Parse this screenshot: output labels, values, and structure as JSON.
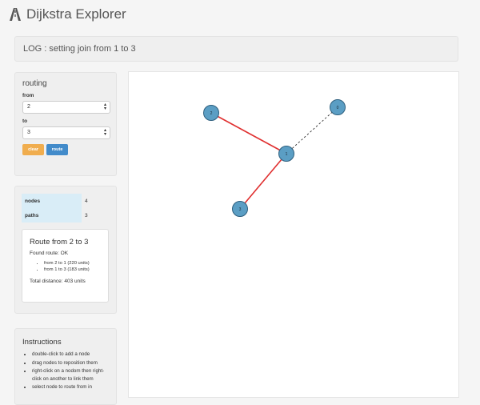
{
  "app": {
    "title": "Dijkstra Explorer",
    "logo_icon": "road-icon"
  },
  "log": {
    "text": "LOG : setting join from 1 to 3"
  },
  "routing": {
    "title": "routing",
    "from_label": "from",
    "from_value": "2",
    "to_label": "to",
    "to_value": "3",
    "clear_label": "clear",
    "route_label": "route",
    "clear_color": "#f0ad4e",
    "route_color": "#428bca"
  },
  "stats": {
    "nodes_label": "nodes",
    "nodes_value": "4",
    "paths_label": "paths",
    "paths_value": "3"
  },
  "route_result": {
    "title": "Route from 2 to 3",
    "status": "Found route: OK",
    "steps": [
      "from 2 to 1 (220 units)",
      "from 1 to 3 (183 units)"
    ],
    "total": "Total distance: 403 units"
  },
  "instructions": {
    "title": "Instructions",
    "items": [
      "double-click to add a node",
      "drag nodes to reposition them",
      "right-click on a nodom then right-click on another to link them",
      "select node to route from in"
    ]
  },
  "graph": {
    "node_color": "#5b9ec4",
    "route_color": "#e03030",
    "link_color": "#333333",
    "nodes": [
      {
        "id": "2",
        "label": "2"
      },
      {
        "id": "0",
        "label": "0"
      },
      {
        "id": "1",
        "label": "1"
      },
      {
        "id": "3",
        "label": "3"
      }
    ],
    "edges": [
      {
        "from": "2",
        "to": "1",
        "style": "route"
      },
      {
        "from": "1",
        "to": "3",
        "style": "route"
      },
      {
        "from": "1",
        "to": "0",
        "style": "dashed"
      }
    ]
  }
}
